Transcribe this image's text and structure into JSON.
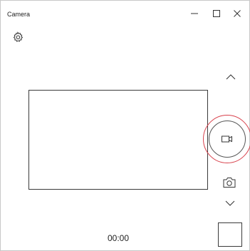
{
  "window": {
    "title": "Camera",
    "controls": [
      "minimize-icon",
      "maximize-icon",
      "close-icon"
    ]
  },
  "toolbar": {
    "settings_icon": "gear-icon"
  },
  "side_panel": {
    "up_icon": "chevron-up-icon",
    "capture_mode": "video",
    "capture_icon": "video-camera-icon",
    "photo_mode_icon": "photo-camera-icon",
    "down_icon": "chevron-down-icon",
    "highlight_color": "#d8404b"
  },
  "status": {
    "timer": "00:00"
  }
}
